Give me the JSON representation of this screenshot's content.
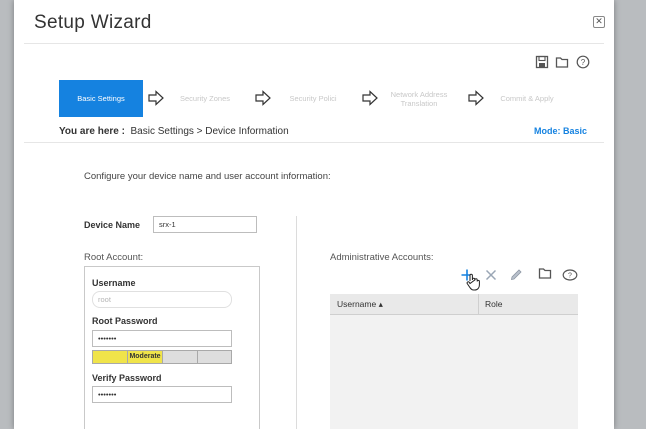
{
  "dialog": {
    "title": "Setup Wizard"
  },
  "steps": [
    {
      "label": "Basic Settings",
      "active": true
    },
    {
      "label": "Security Zones",
      "active": false
    },
    {
      "label": "Security Polici",
      "active": false
    },
    {
      "label": "Network Address Translation",
      "active": false
    },
    {
      "label": "Commit & Apply",
      "active": false
    }
  ],
  "breadcrumb": {
    "prefix": "You are here :",
    "path": "Basic Settings > Device Information"
  },
  "mode": "Mode: Basic",
  "description": "Configure your device name and user account information:",
  "device_name": {
    "label": "Device Name",
    "value": "srx-1"
  },
  "root_account": {
    "label": "Root Account:",
    "username_label": "Username",
    "username_value": "root",
    "password_label": "Root Password",
    "password_value": "•••••••",
    "strength_label": "Moderate",
    "strength_level": 0.75,
    "verify_label": "Verify Password",
    "verify_value": "•••••••"
  },
  "admin_accounts": {
    "label": "Administrative Accounts:",
    "columns": [
      "Username ▴",
      "Role"
    ]
  },
  "colors": {
    "accent": "#1582e0",
    "strength": "#f0e44a"
  },
  "icons": [
    "save-icon",
    "open-folder-icon",
    "help-icon",
    "close-icon",
    "add-icon",
    "delete-icon",
    "edit-icon",
    "folder-icon",
    "hand-cursor-icon"
  ]
}
